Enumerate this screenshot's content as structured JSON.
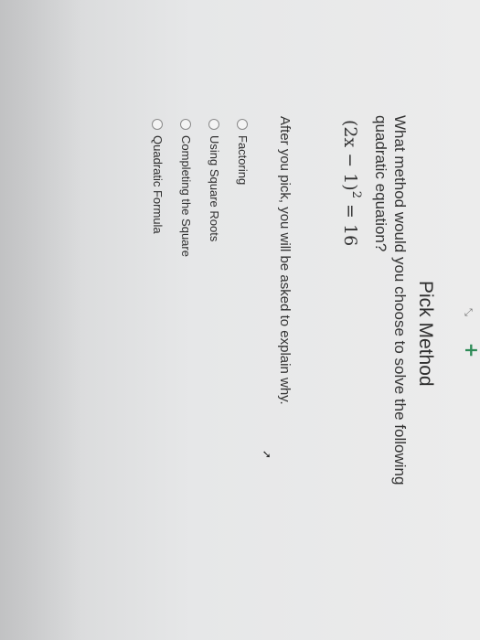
{
  "header": {
    "expand_icon": "expand-arrows-icon",
    "plus_icon": "plus-icon",
    "plus_color": "#2e8b57"
  },
  "title": "Pick Method",
  "question": "What method would you choose to solve the following quadratic equation?",
  "equation": {
    "base": "(2x − 1)",
    "exponent": "2",
    "rhs": "= 16"
  },
  "instruction": "After you pick, you will be asked to explain why.",
  "options": [
    {
      "label": "Factoring",
      "selected": false
    },
    {
      "label": "Using Square Roots",
      "selected": false
    },
    {
      "label": "Completing the Square",
      "selected": false
    },
    {
      "label": "Quadratic Formula",
      "selected": false
    }
  ]
}
